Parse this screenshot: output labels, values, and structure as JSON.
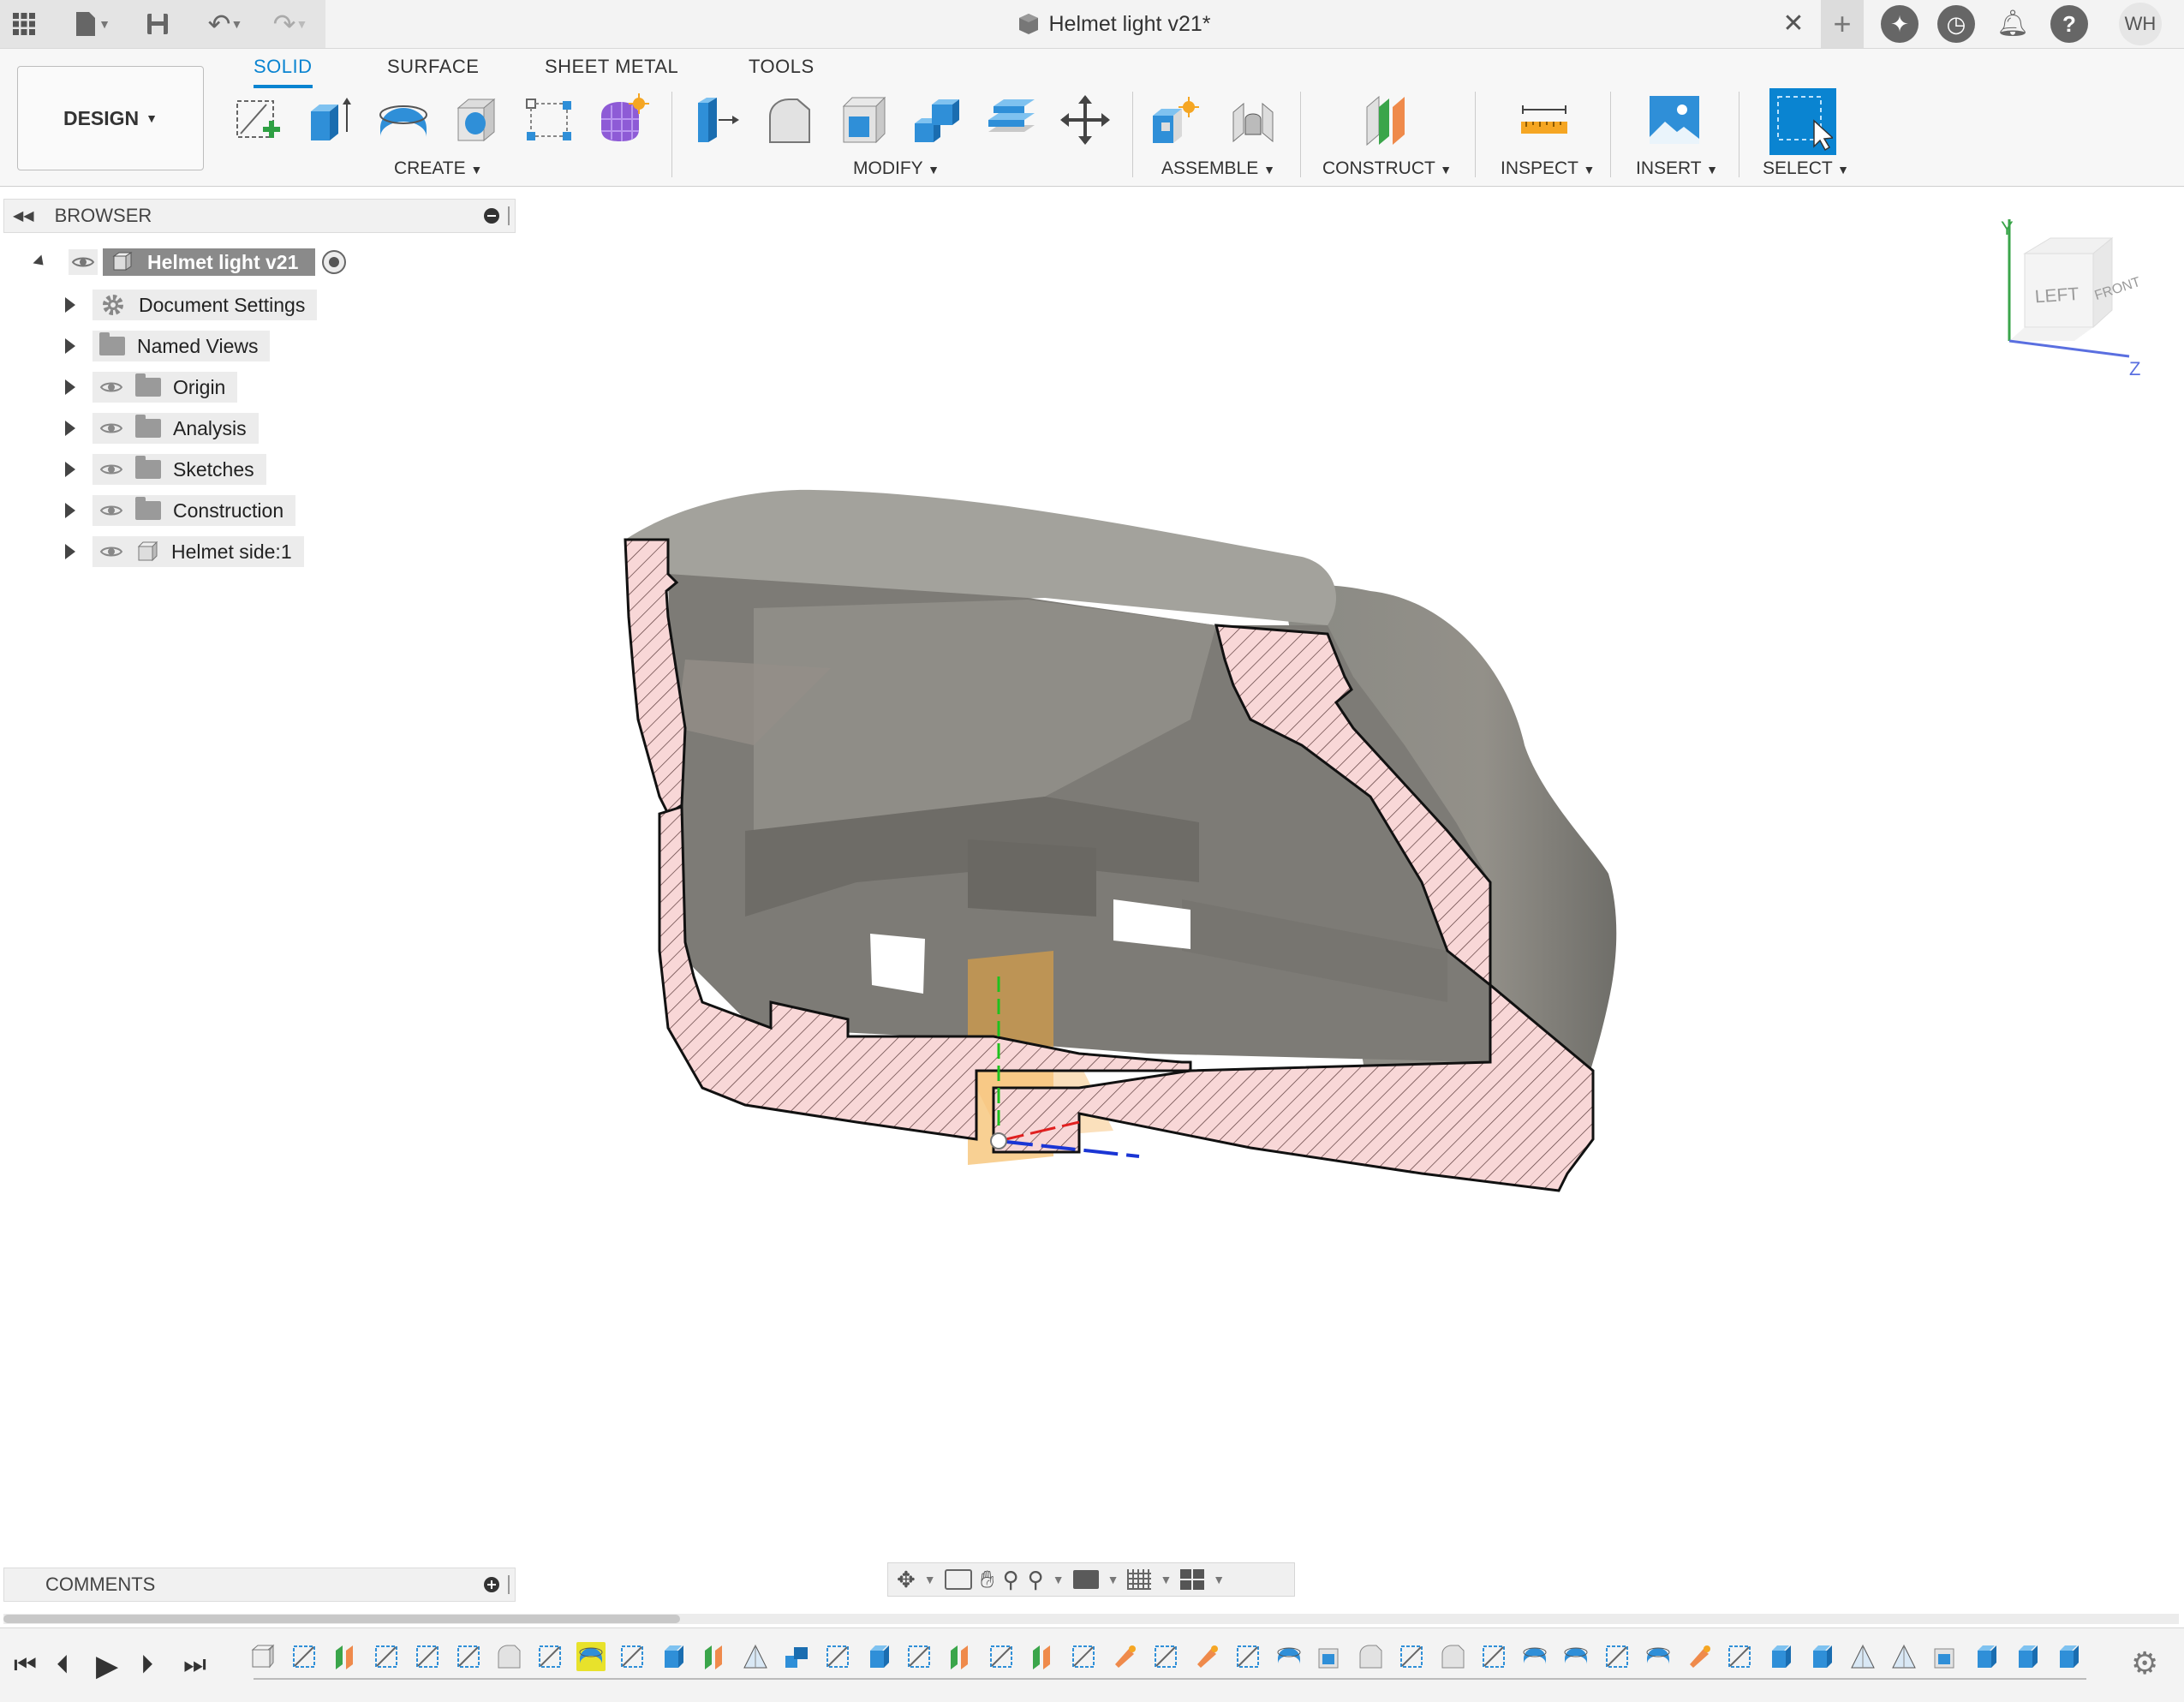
{
  "titlebar": {
    "document_title": "Helmet light v21*",
    "user_initials": "WH"
  },
  "ribbon": {
    "workspace_label": "DESIGN",
    "tabs": [
      "SOLID",
      "SURFACE",
      "SHEET METAL",
      "TOOLS"
    ],
    "active_tab": "SOLID",
    "groups": {
      "create": "CREATE",
      "modify": "MODIFY",
      "assemble": "ASSEMBLE",
      "construct": "CONSTRUCT",
      "inspect": "INSPECT",
      "insert": "INSERT",
      "select": "SELECT"
    }
  },
  "browser": {
    "header": "BROWSER",
    "root": "Helmet light v21",
    "items": [
      {
        "label": "Document Settings",
        "icon": "gear-icon"
      },
      {
        "label": "Named Views",
        "icon": "folder-icon"
      },
      {
        "label": "Origin",
        "icon": "folder-icon"
      },
      {
        "label": "Analysis",
        "icon": "folder-icon"
      },
      {
        "label": "Sketches",
        "icon": "folder-icon"
      },
      {
        "label": "Construction",
        "icon": "folder-icon"
      },
      {
        "label": "Helmet side:1",
        "icon": "body-icon"
      }
    ]
  },
  "viewcube": {
    "left_label": "LEFT",
    "front_label": "FRONT",
    "axis_y": "Y",
    "axis_z": "Z"
  },
  "comments": {
    "header": "COMMENTS"
  },
  "colors": {
    "accent": "#0a84d1",
    "section_hatch": "#f6d3d3",
    "model_gray": "#8c8c86",
    "origin_plane": "#f3a93a"
  }
}
